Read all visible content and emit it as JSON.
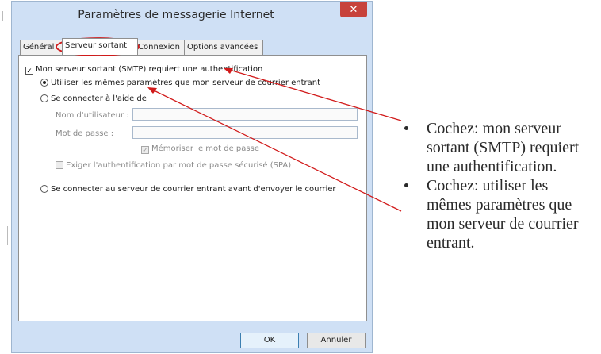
{
  "window": {
    "title": "Paramètres de messagerie Internet",
    "close_glyph": "✕"
  },
  "tabs": [
    {
      "label": "Général",
      "active": false
    },
    {
      "label": "Serveur sortant",
      "active": true
    },
    {
      "label": "Connexion",
      "active": false
    },
    {
      "label": "Options avancées",
      "active": false
    }
  ],
  "panel": {
    "smtp_auth_label": "Mon serveur sortant (SMTP) requiert une authentification",
    "smtp_auth_checked": true,
    "same_settings_label": "Utiliser les mêmes paramètres que mon serveur de courrier entrant",
    "same_settings_selected": true,
    "login_with_label": "Se connecter à l'aide de",
    "login_with_selected": false,
    "username_label": "Nom d'utilisateur :",
    "password_label": "Mot de passe :",
    "remember_label": "Mémoriser le mot de passe",
    "remember_checked": true,
    "spa_label": "Exiger l'authentification par mot de passe sécurisé (SPA)",
    "spa_checked": false,
    "login_before_label": "Se connecter au serveur de courrier entrant avant d'envoyer le courrier",
    "login_before_selected": false
  },
  "buttons": {
    "ok_label": "OK",
    "cancel_label": "Annuler"
  },
  "annotations": {
    "bullets": [
      "Cochez: mon serveur sortant (SMTP) requiert une authentification.",
      "Cochez: utiliser les mêmes paramètres que mon serveur de courrier entrant."
    ],
    "arrow_color": "#d11a1a",
    "highlight_color": "#d11a1a"
  },
  "colors": {
    "window_frame": "#cfe0f5",
    "close_button": "#c7423b"
  }
}
